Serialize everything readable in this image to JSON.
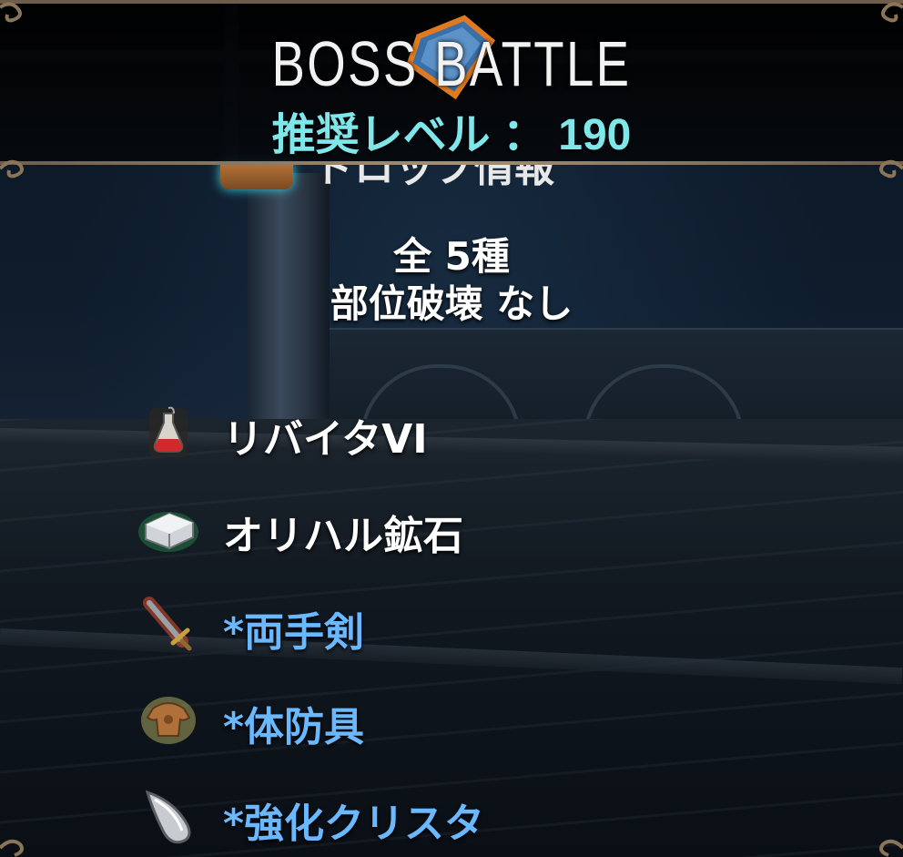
{
  "header": {
    "title": "BOSS  BATTLE",
    "recommended_level": "推奨レベル ： 190"
  },
  "partial_heading": "ドロップ情報",
  "summary": {
    "total": "全 5種",
    "part_break": "部位破壊  なし"
  },
  "drops": [
    {
      "label": "リバイタVI",
      "icon": "potion-icon",
      "color": "#ffffff"
    },
    {
      "label": "オリハル鉱石",
      "icon": "ore-icon",
      "color": "#ffffff"
    },
    {
      "label": "*両手剣",
      "icon": "sword-icon",
      "color": "#6ab8ff"
    },
    {
      "label": "*体防具",
      "icon": "armor-icon",
      "color": "#6ab8ff"
    },
    {
      "label": "*強化クリスタ",
      "icon": "crystal-icon",
      "color": "#6ab8ff"
    }
  ],
  "colors": {
    "level_text": "#7fe6ea",
    "rare_item_text": "#6ab8ff",
    "frame": "#6e5d4a"
  }
}
